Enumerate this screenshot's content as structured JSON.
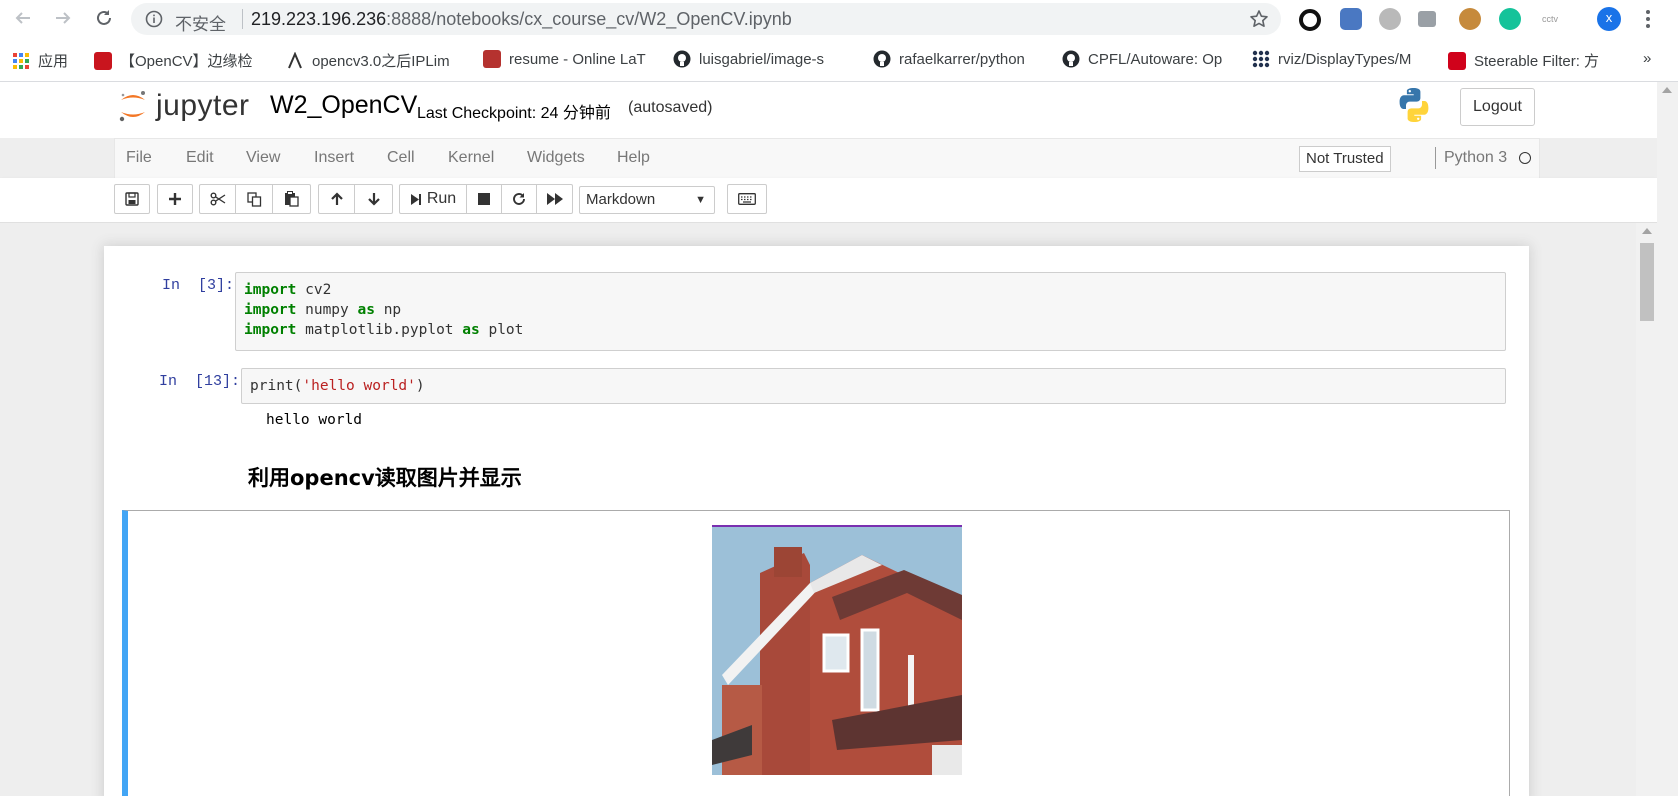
{
  "browser": {
    "security_label": "不安全",
    "url_host": "219.223.196.236",
    "url_port": ":8888",
    "url_path": "/notebooks/cx_course_cv/W2_OpenCV.ipynb",
    "profile_initial": "x",
    "bookmarks": [
      {
        "label": "应用",
        "icon": "apps-grid-icon",
        "color": "#ea4335"
      },
      {
        "label": "【OpenCV】边缘检",
        "icon": "csdn-icon",
        "color": "#c9151e"
      },
      {
        "label": "opencv3.0之后IPLim",
        "icon": "blog-icon",
        "color": "#333333"
      },
      {
        "label": "resume - Online LaT",
        "icon": "sharelatex-icon",
        "color": "#b5322f"
      },
      {
        "label": "luisgabriel/image-s",
        "icon": "github-icon",
        "color": "#24292e"
      },
      {
        "label": "rafaelkarrer/python",
        "icon": "github-icon",
        "color": "#24292e"
      },
      {
        "label": "CPFL/Autoware: Op",
        "icon": "github-icon",
        "color": "#24292e"
      },
      {
        "label": "rviz/DisplayTypes/M",
        "icon": "ros-icon",
        "color": "#22314e"
      },
      {
        "label": "Steerable Filter: 方",
        "icon": "huawei-icon",
        "color": "#d0021b"
      }
    ],
    "bookmarks_more": "»"
  },
  "header": {
    "logo_text": "jupyter",
    "notebook_title": "W2_OpenCV",
    "checkpoint_text": "Last Checkpoint: 24 分钟前",
    "autosave_text": "(autosaved)",
    "logout_label": "Logout"
  },
  "menubar": {
    "items": [
      "File",
      "Edit",
      "View",
      "Insert",
      "Cell",
      "Kernel",
      "Widgets",
      "Help"
    ],
    "trust_label": "Not Trusted",
    "kernel_name": "Python 3"
  },
  "toolbar": {
    "run_label": "Run",
    "cell_type": "Markdown"
  },
  "cells": [
    {
      "prompt": "In  [3]:",
      "lines": [
        [
          {
            "t": "import",
            "c": "kw"
          },
          {
            "t": " cv2"
          }
        ],
        [
          {
            "t": "import",
            "c": "kw"
          },
          {
            "t": " numpy "
          },
          {
            "t": "as",
            "c": "kw"
          },
          {
            "t": " np"
          }
        ],
        [
          {
            "t": "import",
            "c": "kw"
          },
          {
            "t": " matplotlib.pyplot "
          },
          {
            "t": "as",
            "c": "kw"
          },
          {
            "t": " plot"
          }
        ]
      ]
    },
    {
      "prompt": "In  [13]:",
      "lines": [
        [
          {
            "t": "print("
          },
          {
            "t": "'hello world'",
            "c": "str"
          },
          {
            "t": ")"
          }
        ]
      ],
      "output": "hello world"
    }
  ],
  "markdown_heading": "利用opencv读取图片并显示",
  "colors": {
    "accent_selected_cell": "#42a5f5",
    "prompt_in": "#303f9f",
    "keyword": "#008000",
    "string": "#ba2121"
  }
}
